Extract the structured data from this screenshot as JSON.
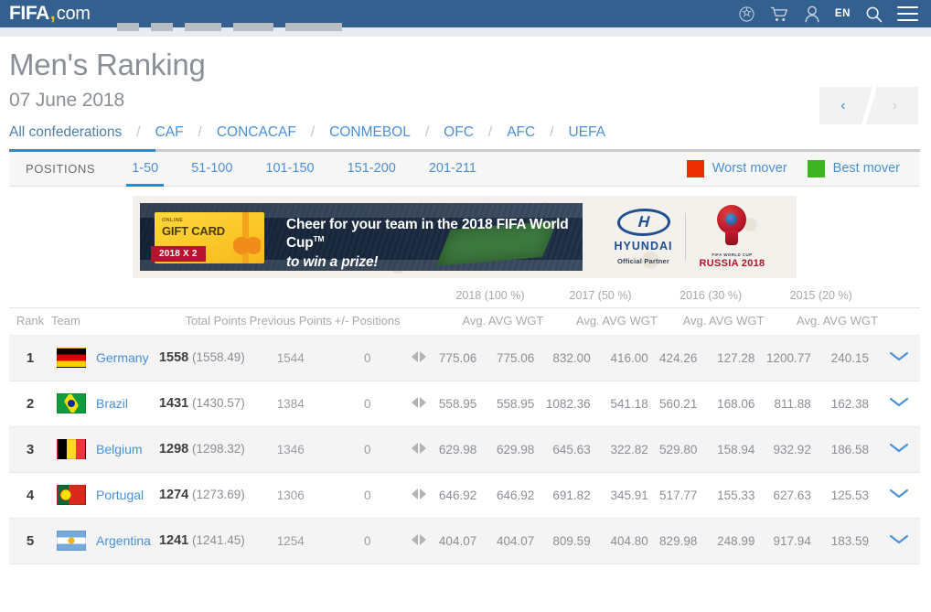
{
  "header": {
    "logo_fifa": "FIFA",
    "logo_comma": ",",
    "logo_com": "com",
    "lang": "EN",
    "icons": [
      "football-icon",
      "cart-icon",
      "user-icon",
      "search-icon",
      "hamburger-menu-icon"
    ]
  },
  "page": {
    "title": "Men's Ranking",
    "date": "07 June 2018",
    "prev_label": "‹",
    "next_label": "›"
  },
  "confederations": [
    {
      "label": "All confederations",
      "active": true
    },
    {
      "label": "CAF",
      "active": false
    },
    {
      "label": "CONCACAF",
      "active": false
    },
    {
      "label": "CONMEBOL",
      "active": false
    },
    {
      "label": "OFC",
      "active": false
    },
    {
      "label": "AFC",
      "active": false
    },
    {
      "label": "UEFA",
      "active": false
    }
  ],
  "confed_separator": "/",
  "positions": {
    "label": "POSITIONS",
    "tabs": [
      {
        "label": "1-50",
        "active": true
      },
      {
        "label": "51-100",
        "active": false
      },
      {
        "label": "101-150",
        "active": false
      },
      {
        "label": "151-200",
        "active": false
      },
      {
        "label": "201-211",
        "active": false
      }
    ],
    "movers": [
      {
        "label": "Worst mover",
        "color": "#ee2d00"
      },
      {
        "label": "Best mover",
        "color": "#3cb521"
      }
    ]
  },
  "advert": {
    "badge_online": "ONLINE",
    "badge_title": "GIFT CARD",
    "badge_ribbon": "2018 X 2",
    "headline_1": "Cheer for your team in the 2018 FIFA World Cup",
    "headline_tm": "TM",
    "headline_2": "to win a prize!",
    "sponsor_name": "HYUNDAI",
    "sponsor_role": "Official Partner",
    "emblem_top": "FIFA WORLD CUP",
    "emblem_name": "RUSSIA 2018"
  },
  "table": {
    "group_headers": [
      {
        "label": "2018 (100 %)"
      },
      {
        "label": "2017 (50 %)"
      },
      {
        "label": "2016 (30 %)"
      },
      {
        "label": "2015 (20 %)"
      }
    ],
    "columns": {
      "rank": "Rank",
      "team": "Team",
      "total_points": "Total Points",
      "previous_points": "Previous Points",
      "positions": "+/- Positions",
      "avg": "Avg.",
      "avg_wgt": "AVG WGT"
    },
    "rows": [
      {
        "rank": "1",
        "team": "Germany",
        "flag": "flag-germany",
        "total_main": "1558",
        "total_paren": "(1558.49)",
        "previous": "1544",
        "diff": "0",
        "move": "no-change",
        "y2018_avg": "775.06",
        "y2018_wgt": "775.06",
        "y2017_avg": "832.00",
        "y2017_wgt": "416.00",
        "y2016_avg": "424.26",
        "y2016_wgt": "127.28",
        "y2015_avg": "1200.77",
        "y2015_wgt": "240.15"
      },
      {
        "rank": "2",
        "team": "Brazil",
        "flag": "flag-brazil",
        "total_main": "1431",
        "total_paren": "(1430.57)",
        "previous": "1384",
        "diff": "0",
        "move": "no-change",
        "y2018_avg": "558.95",
        "y2018_wgt": "558.95",
        "y2017_avg": "1082.36",
        "y2017_wgt": "541.18",
        "y2016_avg": "560.21",
        "y2016_wgt": "168.06",
        "y2015_avg": "811.88",
        "y2015_wgt": "162.38"
      },
      {
        "rank": "3",
        "team": "Belgium",
        "flag": "flag-belgium",
        "total_main": "1298",
        "total_paren": "(1298.32)",
        "previous": "1346",
        "diff": "0",
        "move": "no-change",
        "y2018_avg": "629.98",
        "y2018_wgt": "629.98",
        "y2017_avg": "645.63",
        "y2017_wgt": "322.82",
        "y2016_avg": "529.80",
        "y2016_wgt": "158.94",
        "y2015_avg": "932.92",
        "y2015_wgt": "186.58"
      },
      {
        "rank": "4",
        "team": "Portugal",
        "flag": "flag-portugal",
        "total_main": "1274",
        "total_paren": "(1273.69)",
        "previous": "1306",
        "diff": "0",
        "move": "no-change",
        "y2018_avg": "646.92",
        "y2018_wgt": "646.92",
        "y2017_avg": "691.82",
        "y2017_wgt": "345.91",
        "y2016_avg": "517.77",
        "y2016_wgt": "155.33",
        "y2015_avg": "627.63",
        "y2015_wgt": "125.53"
      },
      {
        "rank": "5",
        "team": "Argentina",
        "flag": "flag-argentina",
        "total_main": "1241",
        "total_paren": "(1241.45)",
        "previous": "1254",
        "diff": "0",
        "move": "no-change",
        "y2018_avg": "404.07",
        "y2018_wgt": "404.07",
        "y2017_avg": "809.59",
        "y2017_wgt": "404.80",
        "y2016_avg": "829.98",
        "y2016_wgt": "248.99",
        "y2015_avg": "917.94",
        "y2015_wgt": "183.59"
      }
    ]
  }
}
